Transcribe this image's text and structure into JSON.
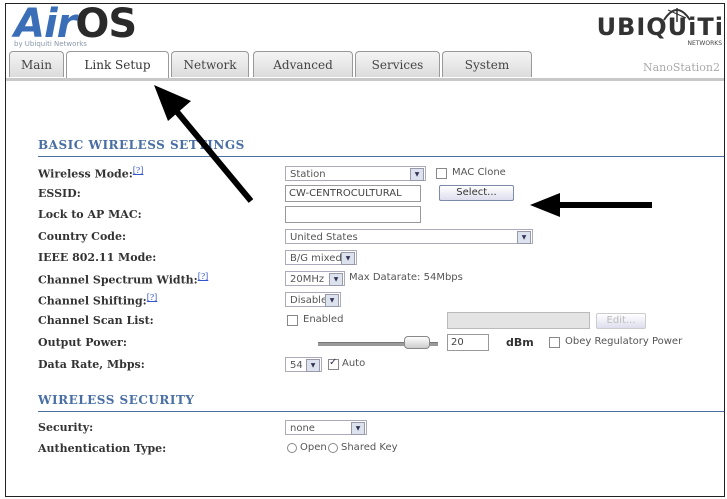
{
  "header": {
    "logo_text_air": "Air",
    "logo_text_os": "OS",
    "logo_subtext": "by Ubiquiti Networks",
    "brand": "UBIQUiTi",
    "brand_sub": "NETWORKS",
    "device_name": "NanoStation2"
  },
  "tabs": [
    "Main",
    "Link Setup",
    "Network",
    "Advanced",
    "Services",
    "System"
  ],
  "active_tab": "Link Setup",
  "basic": {
    "section_title": "BASIC WIRELESS SETTINGS",
    "help_mark": "[?]",
    "wireless_mode": {
      "label": "Wireless Mode:",
      "value": "Station"
    },
    "mac_clone": {
      "label": "MAC Clone",
      "checked": false
    },
    "essid": {
      "label": "ESSID:",
      "value": "CW-CENTROCULTURAL"
    },
    "select_button": "Select...",
    "lock_ap_mac": {
      "label": "Lock to AP MAC:",
      "value": ""
    },
    "country_code": {
      "label": "Country Code:",
      "value": "United States"
    },
    "ieee_mode": {
      "label": "IEEE 802.11 Mode:",
      "value": "B/G mixed"
    },
    "channel_width": {
      "label": "Channel Spectrum Width:",
      "value": "20MHz",
      "max_datarate": "Max Datarate: 54Mbps"
    },
    "channel_shifting": {
      "label": "Channel Shifting:",
      "value": "Disabled"
    },
    "scan_list": {
      "label": "Channel Scan List:",
      "enabled_label": "Enabled",
      "checked": false,
      "edit_button": "Edit..."
    },
    "output_power": {
      "label": "Output Power:",
      "value": "20",
      "unit": "dBm",
      "obey_label": "Obey Regulatory Power"
    },
    "data_rate": {
      "label": "Data Rate, Mbps:",
      "value": "54",
      "auto_label": "Auto",
      "auto_checked": true
    }
  },
  "security": {
    "section_title": "WIRELESS SECURITY",
    "security": {
      "label": "Security:",
      "value": "none"
    },
    "auth_type": {
      "label": "Authentication Type:",
      "open_label": "Open",
      "shared_label": "Shared Key"
    }
  },
  "colors": {
    "accent": "#4a6fa5",
    "logo_blue": "#3a6fb8"
  }
}
